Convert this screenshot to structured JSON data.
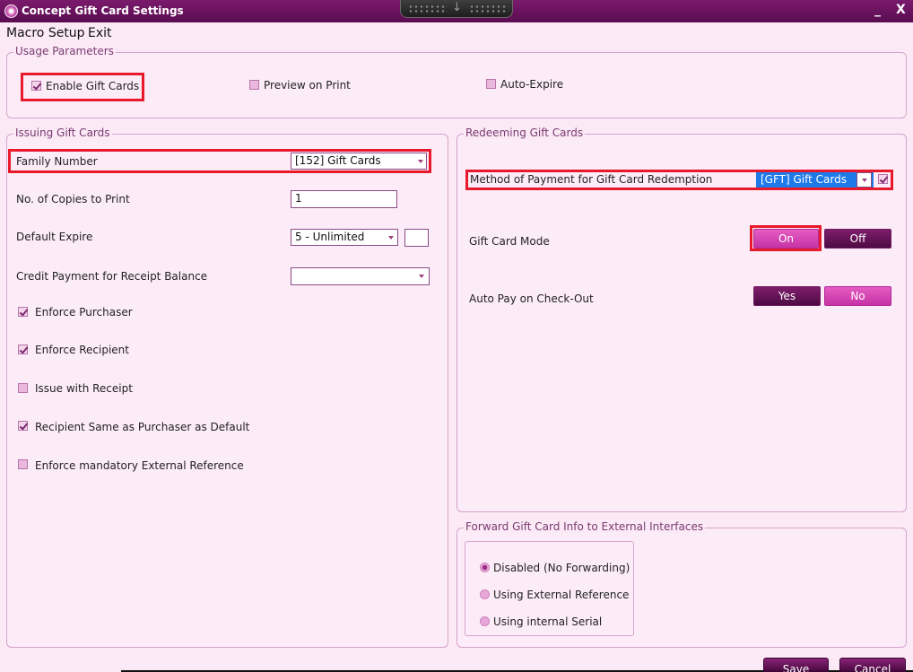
{
  "window": {
    "title": "Concept Gift Card Settings",
    "minimize": "_",
    "close": "X"
  },
  "menu": {
    "items": [
      "Macro Setup",
      "Exit"
    ]
  },
  "usage": {
    "title": "Usage Parameters",
    "enable_gift_cards": {
      "label": "Enable Gift Cards",
      "checked": true
    },
    "preview_on_print": {
      "label": "Preview on Print",
      "checked": false
    },
    "auto_expire": {
      "label": "Auto-Expire",
      "checked": false
    }
  },
  "issuing": {
    "title": "Issuing Gift Cards",
    "family_number": {
      "label": "Family Number",
      "value": "[152] Gift Cards"
    },
    "copies": {
      "label": "No. of Copies to Print",
      "value": "1"
    },
    "default_expire": {
      "label": "Default Expire",
      "value": "5 - Unlimited",
      "extra": ""
    },
    "credit_payment": {
      "label": "Credit Payment for Receipt Balance",
      "value": ""
    },
    "enforce_purchaser": {
      "label": "Enforce Purchaser",
      "checked": true
    },
    "enforce_recipient": {
      "label": "Enforce Recipient",
      "checked": true
    },
    "issue_with_receipt": {
      "label": "Issue with Receipt",
      "checked": false
    },
    "recipient_same": {
      "label": "Recipient Same as Purchaser as Default",
      "checked": true
    },
    "enforce_external_ref": {
      "label": "Enforce mandatory External Reference",
      "checked": false
    }
  },
  "redeeming": {
    "title": "Redeeming Gift Cards",
    "method": {
      "label": "Method of Payment for Gift Card Redemption",
      "value": "[GFT] Gift Cards",
      "checked": true
    },
    "mode": {
      "label": "Gift Card Mode",
      "on": "On",
      "off": "Off",
      "selected": "On"
    },
    "auto_pay": {
      "label": "Auto Pay on Check-Out",
      "yes": "Yes",
      "no": "No",
      "selected": "No"
    }
  },
  "forward": {
    "title": "Forward Gift Card Info to External Interfaces",
    "options": [
      "Disabled (No Forwarding)",
      "Using External Reference",
      "Using internal Serial"
    ],
    "selected": "Disabled (No Forwarding)"
  },
  "footer": {
    "save": "Save",
    "cancel": "Cancel"
  },
  "colors": {
    "background": "#fbe9f6",
    "title_bar": "#5a0c50",
    "accent_on": "#d33fb0",
    "accent_off": "#5e1052",
    "highlight": "#e8192a"
  }
}
